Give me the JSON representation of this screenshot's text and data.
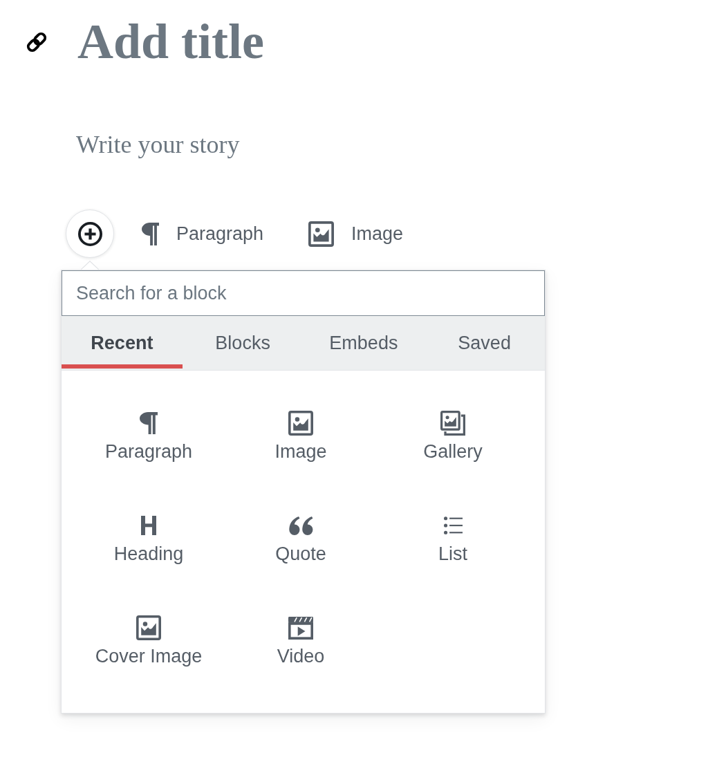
{
  "post": {
    "title": {
      "placeholder": "Add title"
    },
    "body": {
      "placeholder": "Write your story"
    }
  },
  "inserter_bar": {
    "items": [
      {
        "kind": "paragraph",
        "label": "Paragraph"
      },
      {
        "kind": "image",
        "label": "Image"
      }
    ]
  },
  "inserter": {
    "search": {
      "placeholder": "Search for a block"
    },
    "tabs": [
      {
        "label": "Recent",
        "selected": true
      },
      {
        "label": "Blocks",
        "selected": false
      },
      {
        "label": "Embeds",
        "selected": false
      },
      {
        "label": "Saved",
        "selected": false
      }
    ],
    "blocks": [
      {
        "kind": "paragraph",
        "label": "Paragraph"
      },
      {
        "kind": "image",
        "label": "Image"
      },
      {
        "kind": "gallery",
        "label": "Gallery"
      },
      {
        "kind": "heading",
        "label": "Heading"
      },
      {
        "kind": "quote",
        "label": "Quote"
      },
      {
        "kind": "list",
        "label": "List"
      },
      {
        "kind": "cover",
        "label": "Cover Image"
      },
      {
        "kind": "video",
        "label": "Video"
      }
    ]
  }
}
